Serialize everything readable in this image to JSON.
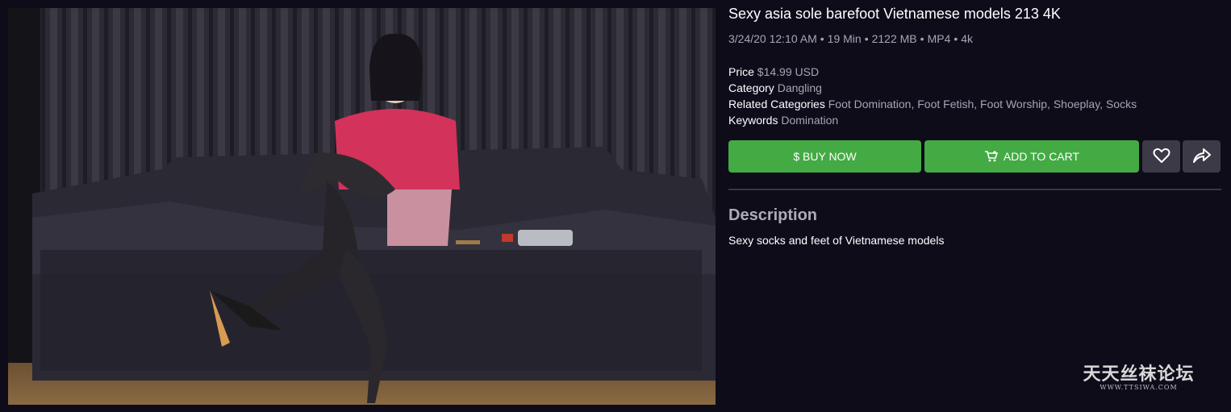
{
  "product": {
    "title": "Sexy asia sole barefoot Vietnamese models 213 4K",
    "meta": {
      "date": "3/24/20 12:10 AM",
      "duration": "19 Min",
      "size": "2122 MB",
      "format": "MP4",
      "resolution": "4k",
      "separator": "•"
    },
    "price_label": "Price",
    "price_value": "$14.99 USD",
    "category_label": "Category",
    "category_value": "Dangling",
    "related_label": "Related Categories",
    "related_value": "Foot Domination, Foot Fetish, Foot Worship, Shoeplay, Socks",
    "keywords_label": "Keywords",
    "keywords_value": "Domination"
  },
  "actions": {
    "buy_label": "$ BUY NOW",
    "cart_label": "ADD TO CART",
    "cart_icon": "cart-icon",
    "like_icon": "heart-icon",
    "share_icon": "share-icon"
  },
  "description": {
    "heading": "Description",
    "text": "Sexy socks and feet of Vietnamese models"
  },
  "watermark": {
    "main": "天天丝袜论坛",
    "sub": "WWW.TTSIWA.COM"
  },
  "colors": {
    "background": "#0f0c1a",
    "accent_green": "#44aa44",
    "icon_button": "#3d3a48",
    "muted_text": "#a7a4b3"
  }
}
